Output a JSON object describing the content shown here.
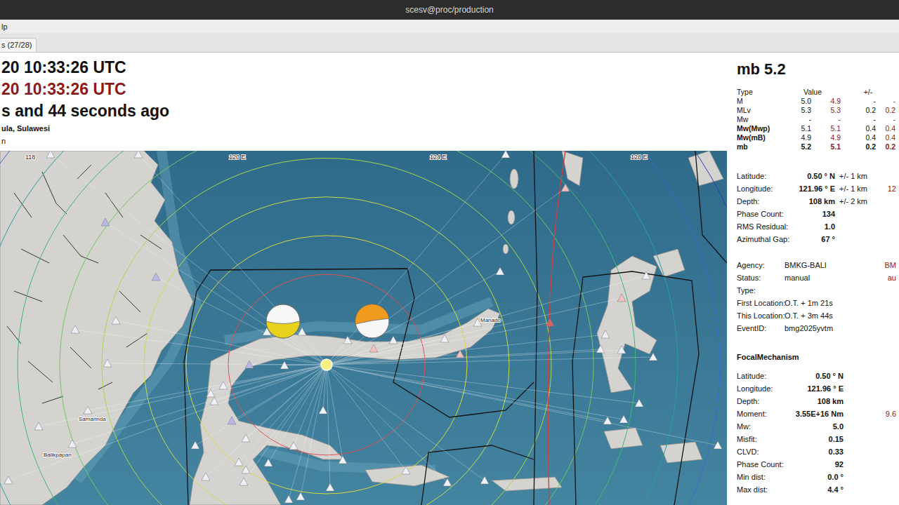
{
  "window": {
    "title": "scesv@proc/production"
  },
  "menu": [
    "lp"
  ],
  "tabs": [
    {
      "label": "s (27/28)",
      "selected": true
    }
  ],
  "event": {
    "origin_time": "20 10:33:26 UTC",
    "origin_time_local": "20 10:33:26 UTC",
    "ago": "s and 44 seconds ago",
    "region": "ula, Sulawesi",
    "extra": "n"
  },
  "map": {
    "axis_labels": [
      "118",
      "120 E",
      "124 E",
      "128 E"
    ],
    "places": [
      "Samarinda",
      "Balikpapan",
      "Manado"
    ],
    "focal_mechanisms": [
      {
        "kind": "lower",
        "color": "#e9d21c"
      },
      {
        "kind": "upper",
        "color": "#f09a1e"
      }
    ]
  },
  "magnitude": {
    "title": "mb 5.2",
    "columns": [
      "Type",
      "Value",
      "+/-"
    ],
    "rows": [
      {
        "type": "M",
        "value": "5.0",
        "value2": "4.9",
        "error": "-",
        "error2": "-",
        "bold": false,
        "preferred": false
      },
      {
        "type": "MLv",
        "value": "5.3",
        "value2": "5.3",
        "error": "0.2",
        "error2": "0.2",
        "bold": false,
        "preferred": false
      },
      {
        "type": "Mw",
        "value": "-",
        "value2": "-",
        "error": "-",
        "error2": "-",
        "bold": false,
        "preferred": false
      },
      {
        "type": "Mw(Mwp)",
        "value": "5.1",
        "value2": "5.1",
        "error": "0.4",
        "error2": "0.4",
        "bold": true,
        "preferred": false
      },
      {
        "type": "Mw(mB)",
        "value": "4.9",
        "value2": "4.9",
        "error": "0.4",
        "error2": "0.4",
        "bold": true,
        "preferred": false
      },
      {
        "type": "mb",
        "value": "5.2",
        "value2": "5.1",
        "error": "0.2",
        "error2": "0.2",
        "bold": true,
        "preferred": true
      }
    ]
  },
  "origin": [
    {
      "label": "Latitude:",
      "value": "0.50 ° N",
      "uncertainty": "+/-  1 km"
    },
    {
      "label": "Longitude:",
      "value": "121.96 ° E",
      "uncertainty": "+/-  1 km",
      "extra": "12"
    },
    {
      "label": "Depth:",
      "value": "108 km",
      "uncertainty": "+/-  2 km"
    },
    {
      "label": "Phase Count:",
      "value": "134"
    },
    {
      "label": "RMS Residual:",
      "value": "1.0"
    },
    {
      "label": "Azimuthal Gap:",
      "value": "67 °"
    }
  ],
  "agency": [
    {
      "label": "Agency:",
      "value": "BMKG-BALI",
      "extra": "BM"
    },
    {
      "label": "Status:",
      "value": "manual",
      "extra": "au"
    },
    {
      "label": "Type:"
    },
    {
      "label": "First Location:",
      "value": "O.T. + 1m 21s"
    },
    {
      "label": "This Location:",
      "value": "O.T. + 3m 44s"
    },
    {
      "label": "EventID:",
      "value": "bmg2025yvtm"
    }
  ],
  "focal_mechanism": {
    "title": "FocalMechanism",
    "rows": [
      {
        "label": "Latitude:",
        "value": "0.50 ° N"
      },
      {
        "label": "Longitude:",
        "value": "121.96 ° E"
      },
      {
        "label": "Depth:",
        "value": "108 km"
      },
      {
        "label": "Moment:",
        "value": "3.55E+16 Nm",
        "extra": "9.6"
      },
      {
        "label": "Mw:",
        "value": "5.0"
      },
      {
        "label": "Misfit:",
        "value": "0.15"
      },
      {
        "label": "CLVD:",
        "value": "0.33"
      },
      {
        "label": "Phase Count:",
        "value": "92"
      },
      {
        "label": "Min dist:",
        "value": "0.0 °"
      },
      {
        "label": "Max dist:",
        "value": "4.4 °"
      }
    ]
  }
}
